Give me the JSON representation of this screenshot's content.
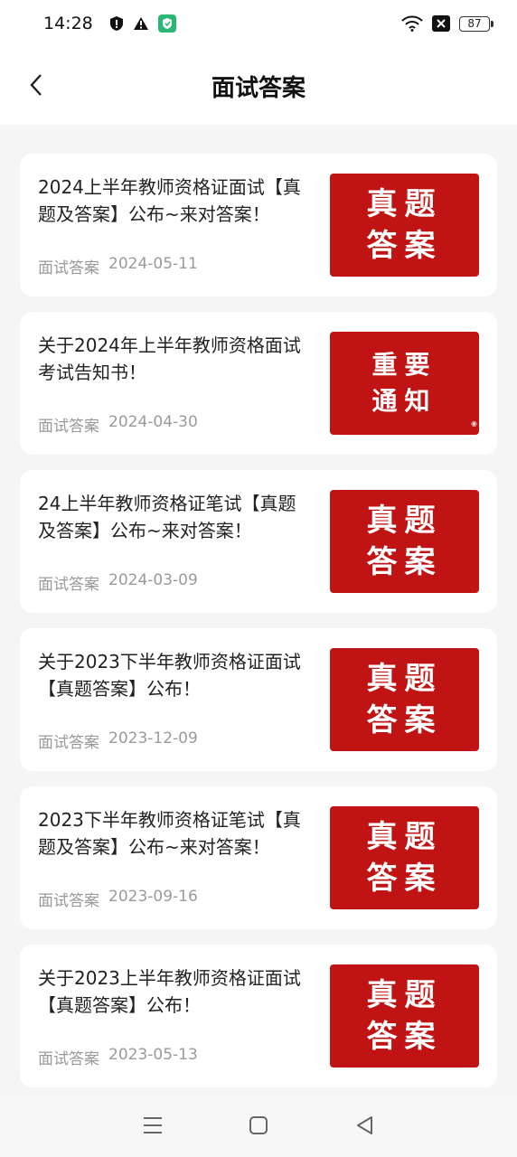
{
  "status_bar": {
    "time": "14:28",
    "left_icons": [
      "shield-icon",
      "warning-icon",
      "app-shield-icon"
    ],
    "right_icons": [
      "wifi-icon",
      "close-box-icon",
      "battery-icon"
    ],
    "battery": "87"
  },
  "header": {
    "title": "面试答案",
    "back_icon": "chevron-left-icon"
  },
  "articles": [
    {
      "title": "2024上半年教师资格证面试【真题及答案】公布~来对答案！",
      "category": "面试答案",
      "date": "2024-05-11",
      "thumb": {
        "line1": "真题",
        "line2": "答案"
      }
    },
    {
      "title": "关于2024年上半年教师资格面试考试告知书！",
      "category": "面试答案",
      "date": "2024-04-30",
      "thumb": {
        "line1": "重要",
        "line2": "通知"
      }
    },
    {
      "title": "24上半年教师资格证笔试【真题及答案】公布~来对答案！",
      "category": "面试答案",
      "date": "2024-03-09",
      "thumb": {
        "line1": "真题",
        "line2": "答案"
      }
    },
    {
      "title": "关于2023下半年教师资格证面试【真题答案】公布！",
      "category": "面试答案",
      "date": "2023-12-09",
      "thumb": {
        "line1": "真题",
        "line2": "答案"
      }
    },
    {
      "title": "2023下半年教师资格证笔试【真题及答案】公布~来对答案！",
      "category": "面试答案",
      "date": "2023-09-16",
      "thumb": {
        "line1": "真题",
        "line2": "答案"
      }
    },
    {
      "title": "关于2023上半年教师资格证面试【真题答案】公布！",
      "category": "面试答案",
      "date": "2023-05-13",
      "thumb": {
        "line1": "真题",
        "line2": "答案"
      }
    }
  ],
  "nav_bar": {
    "icons": [
      "menu-icon",
      "home-square-icon",
      "back-triangle-icon"
    ]
  },
  "colors": {
    "thumb_red": "#c01313",
    "background": "#f5f5f5"
  }
}
